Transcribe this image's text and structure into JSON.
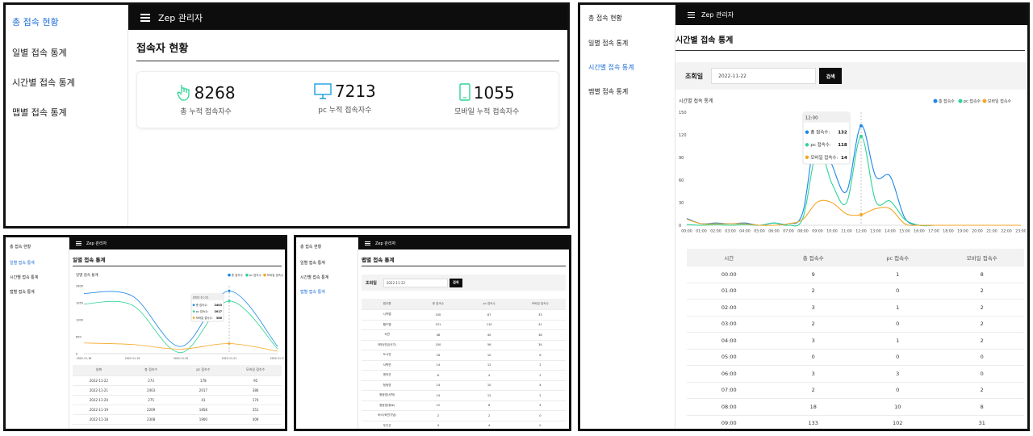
{
  "app_title": "Zep 관리자",
  "sidebar_items": [
    "총 접속 현황",
    "일별 접속 통계",
    "시간별 접속 통계",
    "맵별 접속 통계"
  ],
  "colors": {
    "total": "#1a86e8",
    "pc": "#2dd493",
    "mobile": "#f5a623",
    "accent": "#1e6fd6",
    "topbar": "#0d0d0d"
  },
  "overview": {
    "title": "접속자 현황",
    "stats": [
      {
        "icon": "touch-hand-icon",
        "value": "8268",
        "label": "총 누적 접속자수"
      },
      {
        "icon": "monitor-icon",
        "value": "7213",
        "label": "pc 누적 접속자수"
      },
      {
        "icon": "mobile-phone-icon",
        "value": "1055",
        "label": "모바일 누적 접속자수"
      }
    ]
  },
  "daily": {
    "title": "일별 접속 통계",
    "chart_title": "일별 접속 통계",
    "table_headers": [
      "날짜",
      "총 접속수",
      "pc 접속수",
      "모바일 접속수"
    ],
    "table_rows": [
      [
        "2022-11-22",
        "273",
        "178",
        "95"
      ],
      [
        "2022-11-21",
        "2403",
        "2017",
        "386"
      ],
      [
        "2022-11-20",
        "275",
        "41",
        "174"
      ],
      [
        "2022-11-19",
        "2209",
        "1858",
        "351"
      ],
      [
        "2022-11-18",
        "2308",
        "1900",
        "409"
      ]
    ],
    "tooltip": {
      "title": "2022-11-21",
      "rows": [
        [
          "총 접속수:",
          "2403"
        ],
        [
          "pc 접속수:",
          "2017"
        ],
        [
          "모바일 접속수:",
          "386"
        ]
      ]
    }
  },
  "map": {
    "title": "맵별 접속 통계",
    "search_label": "조회일",
    "search_value": "2022-11-22",
    "search_button": "검색",
    "table_headers": [
      "맵이름",
      "총 접속수",
      "pc 접속수",
      "모바일 접속수"
    ],
    "table_rows": [
      [
        "시작맵",
        "100",
        "67",
        "33"
      ],
      [
        "월드맵",
        "151",
        "110",
        "41"
      ],
      [
        "숙연",
        "48",
        "40",
        "38"
      ],
      [
        "메타(연금사기)",
        "100",
        "56",
        "34"
      ],
      [
        "도시연",
        "16",
        "10",
        "6"
      ],
      [
        "서학연",
        "14",
        "12",
        "2"
      ],
      [
        "엔터관",
        "6",
        "4",
        "2"
      ],
      [
        "청정영",
        "14",
        "10",
        "4"
      ],
      [
        "청정영(서학)",
        "14",
        "12",
        "2"
      ],
      [
        "청정영(종로)",
        "12",
        "8",
        "4"
      ],
      [
        "버스(혁연기념)",
        "2",
        "2",
        "0"
      ],
      [
        "우주선",
        "4",
        "4",
        "0"
      ]
    ]
  },
  "hourly": {
    "title": "시간별 접속 통계",
    "search_label": "조회일",
    "search_value": "2022-11-22",
    "search_button": "검색",
    "tooltip": {
      "title": "12:00",
      "rows": [
        [
          "총 접속수:",
          "132"
        ],
        [
          "pc 접속수:",
          "118"
        ],
        [
          "모바일 접속수:",
          "14"
        ]
      ]
    },
    "table_headers": [
      "시간",
      "총 접속수",
      "pc 접속수",
      "모바일 접속수"
    ],
    "table_rows": [
      [
        "00:00",
        "9",
        "1",
        "8"
      ],
      [
        "01:00",
        "2",
        "0",
        "2"
      ],
      [
        "02:00",
        "3",
        "1",
        "2"
      ],
      [
        "03:00",
        "2",
        "0",
        "2"
      ],
      [
        "04:00",
        "3",
        "1",
        "2"
      ],
      [
        "05:00",
        "0",
        "0",
        "0"
      ],
      [
        "06:00",
        "3",
        "3",
        "0"
      ],
      [
        "07:00",
        "2",
        "0",
        "2"
      ],
      [
        "08:00",
        "18",
        "10",
        "8"
      ],
      [
        "09:00",
        "133",
        "102",
        "31"
      ]
    ]
  },
  "chart_data": [
    {
      "type": "line",
      "title": "일별 접속 통계",
      "x": [
        "2022-11-18",
        "2022-11-19",
        "2022-11-20",
        "2022-11-21",
        "2022-11-22"
      ],
      "ylim": [
        0,
        2600
      ],
      "yticks": [
        0,
        650,
        1300,
        1950,
        2600
      ],
      "legend": "top-right",
      "series": [
        {
          "name": "총 접속수",
          "values": [
            2308,
            2209,
            275,
            2403,
            273
          ]
        },
        {
          "name": "pc 접속수",
          "values": [
            1900,
            1858,
            41,
            2017,
            178
          ]
        },
        {
          "name": "모바일 접속수",
          "values": [
            409,
            351,
            174,
            386,
            95
          ]
        }
      ]
    },
    {
      "type": "line",
      "title": "시간별 접속 통계",
      "x": [
        "00:00",
        "01:00",
        "02:00",
        "03:00",
        "04:00",
        "05:00",
        "06:00",
        "07:00",
        "08:00",
        "09:00",
        "10:00",
        "11:00",
        "12:00",
        "13:00",
        "14:00",
        "15:00",
        "16:00",
        "17:00",
        "18:00",
        "19:00",
        "20:00",
        "21:00",
        "22:00",
        "23:00"
      ],
      "ylim": [
        0,
        150
      ],
      "yticks": [
        0,
        30,
        60,
        90,
        120,
        150
      ],
      "legend": "top-right",
      "series": [
        {
          "name": "총 접속수",
          "values": [
            9,
            2,
            3,
            2,
            3,
            0,
            3,
            2,
            18,
            133,
            80,
            45,
            132,
            65,
            65,
            10,
            0,
            0,
            0,
            0,
            0,
            0,
            0,
            0
          ]
        },
        {
          "name": "pc 접속수",
          "values": [
            1,
            0,
            1,
            0,
            1,
            0,
            3,
            0,
            10,
            102,
            55,
            30,
            118,
            32,
            32,
            8,
            0,
            0,
            0,
            0,
            0,
            0,
            0,
            0
          ]
        },
        {
          "name": "모바일 접속수",
          "values": [
            8,
            2,
            2,
            2,
            2,
            0,
            0,
            2,
            8,
            31,
            30,
            15,
            14,
            22,
            22,
            2,
            0,
            0,
            0,
            0,
            0,
            0,
            0,
            0
          ]
        }
      ]
    }
  ]
}
